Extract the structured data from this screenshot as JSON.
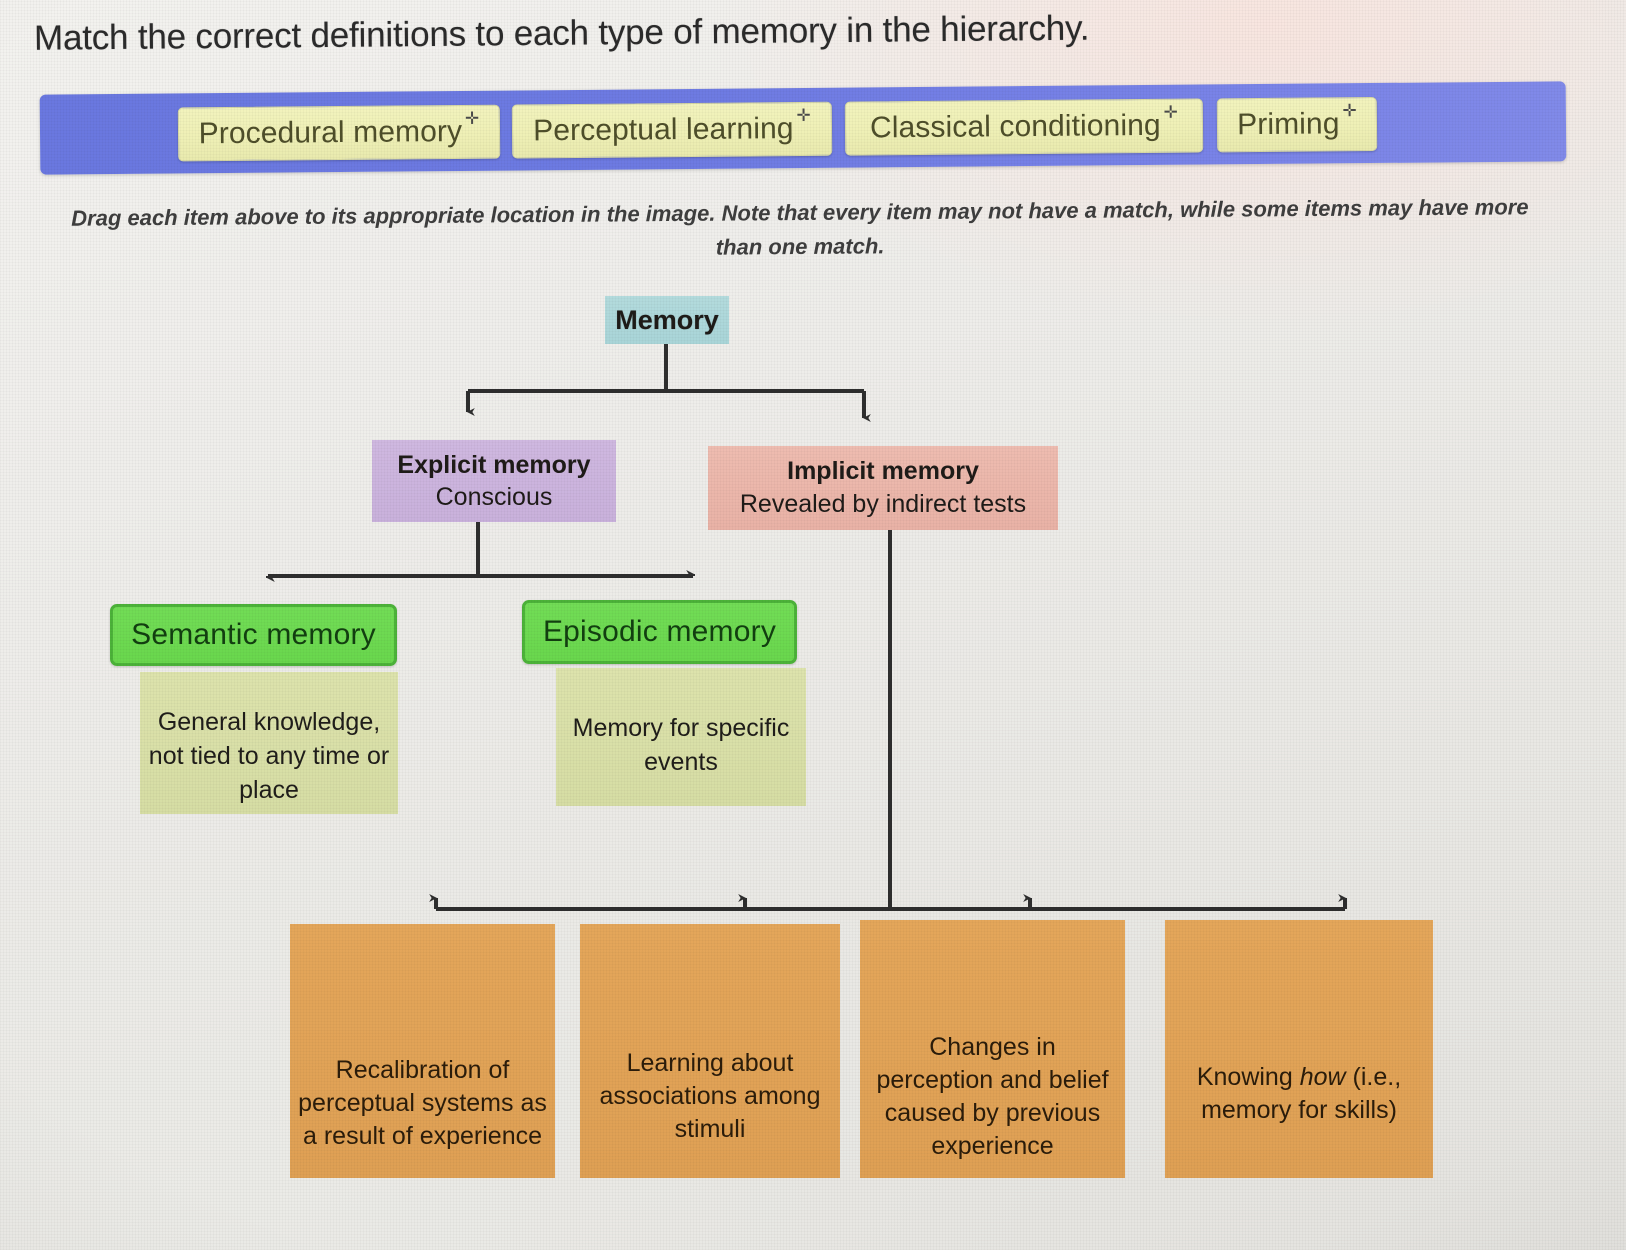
{
  "question": "Match the correct definitions to each type of memory in the hierarchy.",
  "instructions": "Drag each item above to its appropriate location in the image. Note that every item may not have a match, while some items may have more than one match.",
  "tray": {
    "background_color": "#6d7ae2",
    "chip_color": "#eff0b6",
    "move_icon": "✛",
    "chips": [
      {
        "label": "Procedural memory",
        "icon": "move-icon"
      },
      {
        "label": "Perceptual learning",
        "icon": "move-icon"
      },
      {
        "label": "Classical conditioning",
        "icon": "move-icon"
      },
      {
        "label": "Priming",
        "icon": "move-icon"
      }
    ]
  },
  "diagram": {
    "root": {
      "label": "Memory",
      "color": "#a9d5d8"
    },
    "explicit": {
      "title": "Explicit memory",
      "subtitle": "Conscious",
      "color": "#c9b1dc"
    },
    "implicit": {
      "title": "Implicit memory",
      "subtitle": "Revealed by indirect tests",
      "color": "#e9b2a6"
    },
    "dropzones": [
      {
        "label": "Semantic memory",
        "color": "#69d74d",
        "border_color": "#4cb339"
      },
      {
        "label": "Episodic memory",
        "color": "#69d74d",
        "border_color": "#4cb339"
      }
    ],
    "explicit_children": [
      {
        "text": "General knowledge, not tied to any time or place",
        "color": "#d6dda4"
      },
      {
        "text": "Memory for specific events",
        "color": "#d6dda4"
      }
    ],
    "implicit_children": [
      {
        "text": "Recalibration of perceptual systems as a result of experience",
        "color": "#dfa054"
      },
      {
        "text": "Learning about associations among stimuli",
        "color": "#dfa054"
      },
      {
        "text": "Changes in perception and belief caused by previous experience",
        "color": "#dfa054"
      },
      {
        "text": "Knowing how (i.e., memory for skills)",
        "color": "#dfa054"
      }
    ],
    "connector_color": "#2e2e2e"
  }
}
